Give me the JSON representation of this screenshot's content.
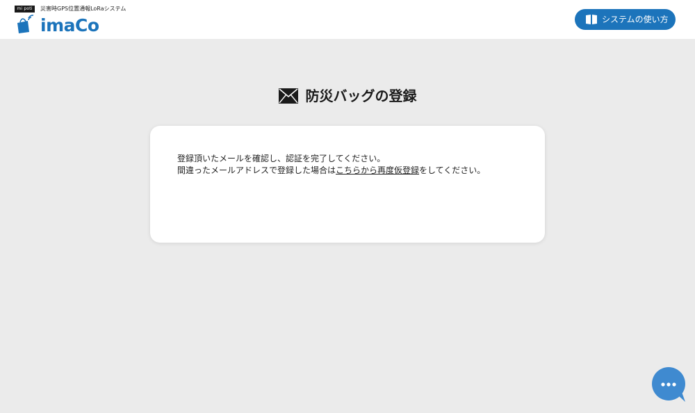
{
  "header": {
    "badge_text": "mi poti",
    "tagline": "災害時GPS位置通報LoRaシステム",
    "logo_text": "imaCo",
    "guide_button_label": "システムの使い方"
  },
  "page": {
    "title": "防災バッグの登録"
  },
  "card": {
    "line1": "登録頂いたメールを確認し、認証を完了してください。",
    "line2_prefix": "間違ったメールアドレスで登録した場合は",
    "line2_link": "こちらから再度仮登録",
    "line2_suffix": "をしてください。"
  },
  "icons": {
    "logo": "shopping-bag-signal-icon",
    "guide": "book-icon",
    "title": "envelope-icon",
    "chat": "chat-bubble-icon"
  },
  "colors": {
    "brand_blue": "#1c74bb",
    "chat_blue": "#3f8ad0",
    "background": "#ebebeb",
    "card": "#ffffff"
  }
}
